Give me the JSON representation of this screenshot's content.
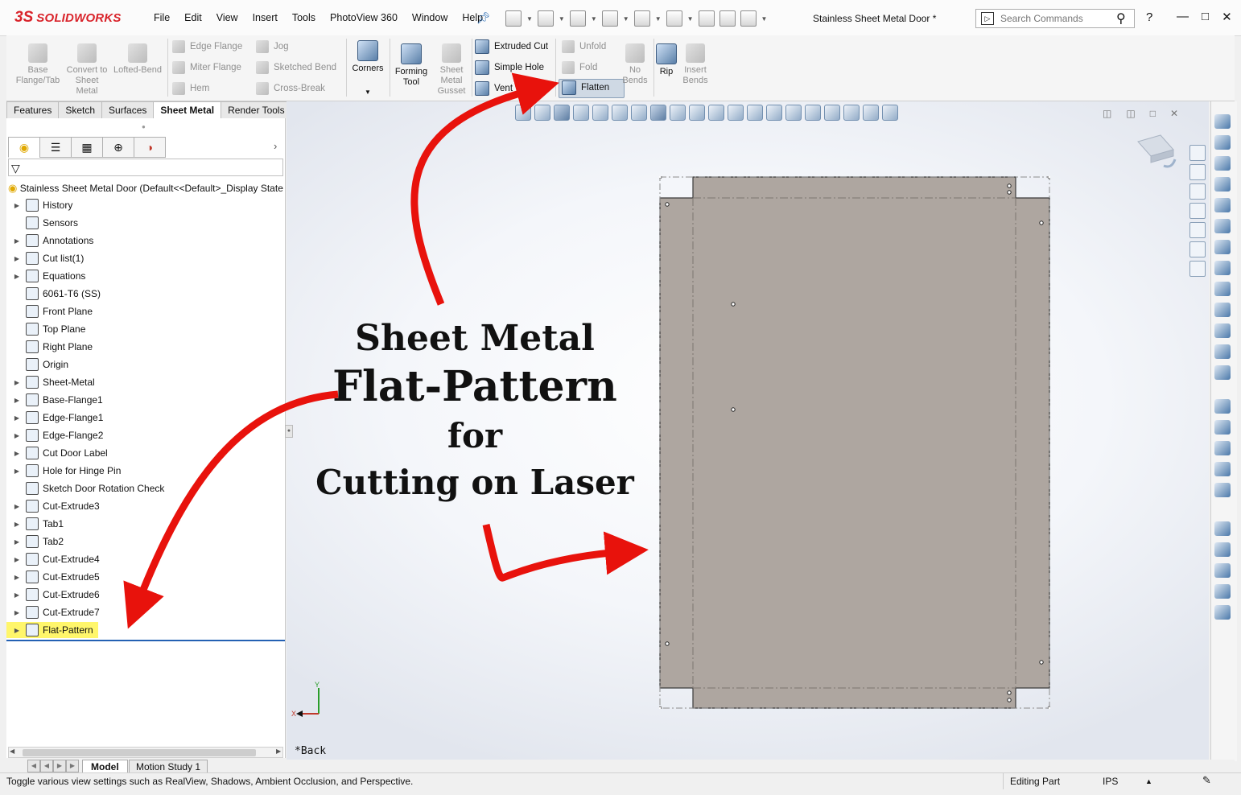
{
  "app": {
    "logo_text": "SOLIDWORKS",
    "logo_mark": "3S",
    "document_title": "Stainless Sheet Metal Door *"
  },
  "menu": [
    "File",
    "Edit",
    "View",
    "Insert",
    "Tools",
    "PhotoView 360",
    "Window",
    "Help"
  ],
  "search": {
    "placeholder": "Search Commands"
  },
  "command_manager": {
    "base_flange": "Base Flange/Tab",
    "convert": "Convert to Sheet Metal",
    "lofted_bend": "Lofted-Bend",
    "edge_flange": "Edge Flange",
    "miter_flange": "Miter Flange",
    "hem": "Hem",
    "jog": "Jog",
    "sketched_bend": "Sketched Bend",
    "cross_break": "Cross-Break",
    "corners": "Corners",
    "forming_tool": "Forming Tool",
    "gusset": "Sheet Metal Gusset",
    "extruded_cut": "Extruded Cut",
    "simple_hole": "Simple Hole",
    "vent": "Vent",
    "unfold": "Unfold",
    "fold": "Fold",
    "flatten": "Flatten",
    "no_bends": "No Bends",
    "rip": "Rip",
    "insert_bends": "Insert Bends"
  },
  "tabs": [
    {
      "label": "Features",
      "active": false
    },
    {
      "label": "Sketch",
      "active": false
    },
    {
      "label": "Surfaces",
      "active": false
    },
    {
      "label": "Sheet Metal",
      "active": true
    },
    {
      "label": "Render Tools",
      "active": false
    }
  ],
  "feature_tree": {
    "root": "Stainless Sheet Metal Door  (Default<<Default>_Display State",
    "items": [
      {
        "label": "History",
        "expandable": true
      },
      {
        "label": "Sensors",
        "expandable": false
      },
      {
        "label": "Annotations",
        "expandable": true
      },
      {
        "label": "Cut list(1)",
        "expandable": true
      },
      {
        "label": "Equations",
        "expandable": true
      },
      {
        "label": "6061-T6 (SS)",
        "expandable": false
      },
      {
        "label": "Front Plane",
        "expandable": false
      },
      {
        "label": "Top Plane",
        "expandable": false
      },
      {
        "label": "Right Plane",
        "expandable": false
      },
      {
        "label": "Origin",
        "expandable": false
      },
      {
        "label": "Sheet-Metal",
        "expandable": true
      },
      {
        "label": "Base-Flange1",
        "expandable": true
      },
      {
        "label": "Edge-Flange1",
        "expandable": true
      },
      {
        "label": "Edge-Flange2",
        "expandable": true
      },
      {
        "label": "Cut Door Label",
        "expandable": true
      },
      {
        "label": "Hole for Hinge Pin",
        "expandable": true
      },
      {
        "label": "Sketch Door Rotation Check",
        "expandable": false
      },
      {
        "label": "Cut-Extrude3",
        "expandable": true
      },
      {
        "label": "Tab1",
        "expandable": true
      },
      {
        "label": "Tab2",
        "expandable": true
      },
      {
        "label": "Cut-Extrude4",
        "expandable": true
      },
      {
        "label": "Cut-Extrude5",
        "expandable": true
      },
      {
        "label": "Cut-Extrude6",
        "expandable": true
      },
      {
        "label": "Cut-Extrude7",
        "expandable": true
      },
      {
        "label": "Flat-Pattern",
        "expandable": true,
        "selected": true
      }
    ]
  },
  "annotation": {
    "line1": "Sheet Metal",
    "line2": "Flat-Pattern",
    "line3": "for",
    "line4": "Cutting on Laser",
    "arrow_color": "#e8120c"
  },
  "viewport": {
    "back_label": "*Back",
    "triad_y": "Y",
    "triad_x": "X"
  },
  "bottom_tabs": {
    "model": "Model",
    "motion": "Motion Study 1"
  },
  "status_bar": {
    "message": "Toggle various view settings such as RealView, Shadows, Ambient Occlusion, and Perspective.",
    "mode": "Editing Part",
    "units": "IPS"
  },
  "colors": {
    "sheet_fill": "#aea6a0",
    "highlight": "#fff66b",
    "brand": "#d9242b"
  }
}
